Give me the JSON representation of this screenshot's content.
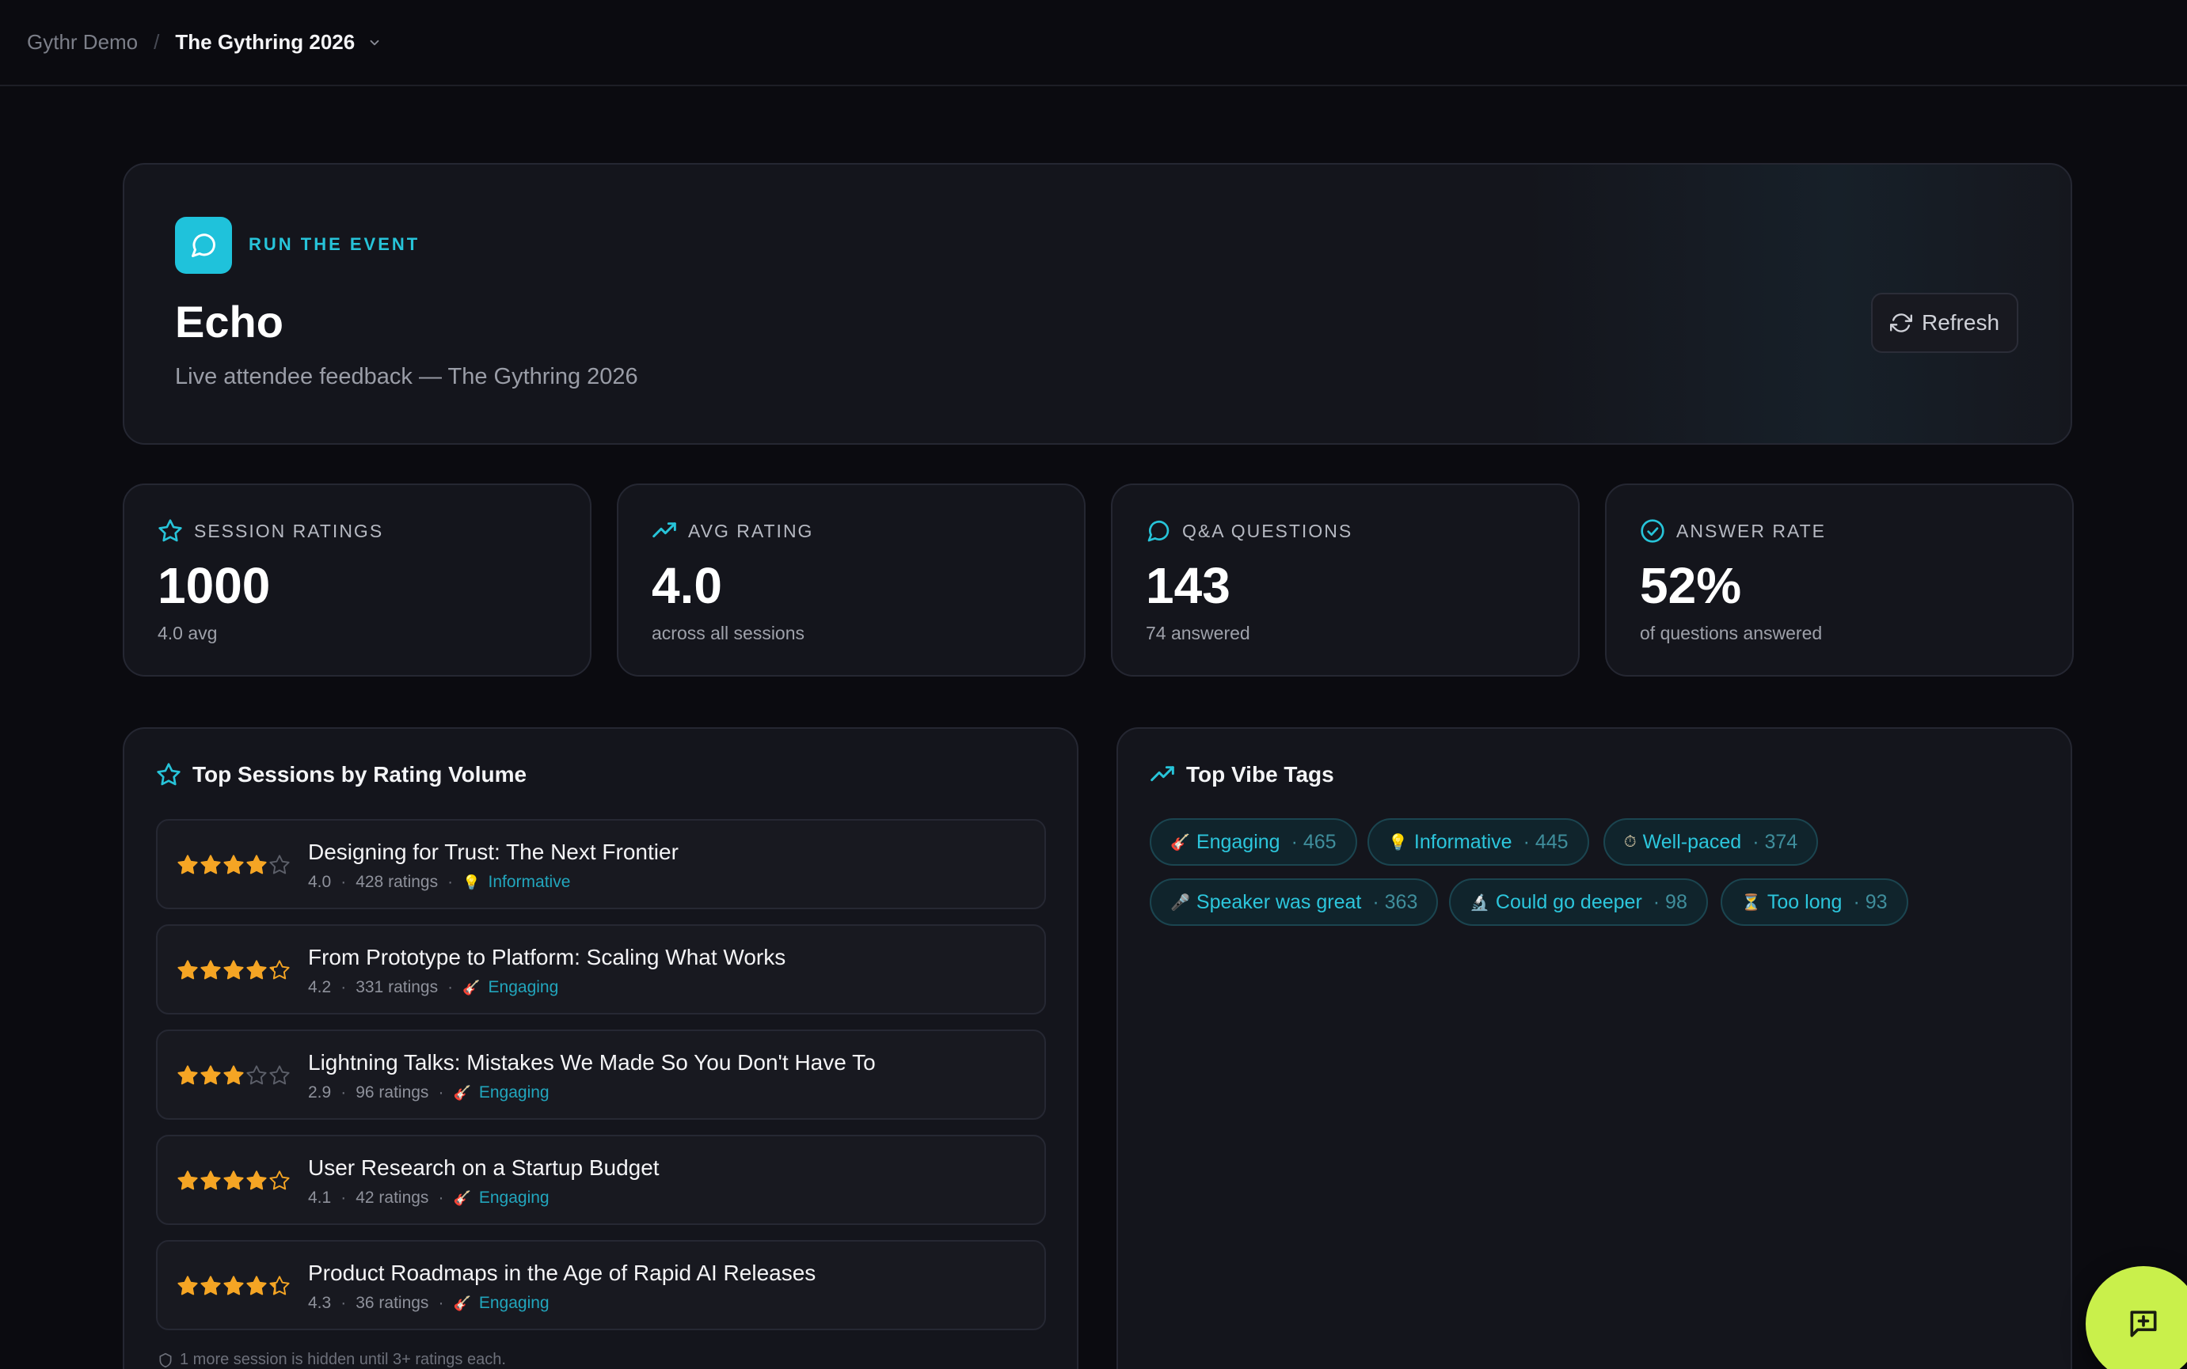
{
  "breadcrumb": {
    "org": "Gythr Demo",
    "separator": "/",
    "event": "The Gythring 2026"
  },
  "hero": {
    "eyebrow": "RUN THE EVENT",
    "title": "Echo",
    "subtitle": "Live attendee feedback — The Gythring 2026",
    "refresh_label": "Refresh"
  },
  "stats": [
    {
      "icon": "star-icon",
      "label": "SESSION RATINGS",
      "value": "1000",
      "sub": "4.0 avg"
    },
    {
      "icon": "trend-up-icon",
      "label": "AVG RATING",
      "value": "4.0",
      "sub": "across all sessions"
    },
    {
      "icon": "chat-bubble-icon",
      "label": "Q&A QUESTIONS",
      "value": "143",
      "sub": "74 answered"
    },
    {
      "icon": "check-circle-icon",
      "label": "ANSWER RATE",
      "value": "52%",
      "sub": "of questions answered"
    }
  ],
  "sessions_panel": {
    "title": "Top Sessions by Rating Volume",
    "items": [
      {
        "title": "Designing for Trust: The Next Frontier",
        "rating": 4.0,
        "rating_text": "4.0",
        "ratings": "428 ratings",
        "tag_emoji": "💡",
        "tag": "Informative"
      },
      {
        "title": "From Prototype to Platform: Scaling What Works",
        "rating": 4.2,
        "rating_text": "4.2",
        "ratings": "331 ratings",
        "tag_emoji": "🎸",
        "tag": "Engaging"
      },
      {
        "title": "Lightning Talks: Mistakes We Made So You Don't Have To",
        "rating": 2.9,
        "rating_text": "2.9",
        "ratings": "96 ratings",
        "tag_emoji": "🎸",
        "tag": "Engaging"
      },
      {
        "title": "User Research on a Startup Budget",
        "rating": 4.1,
        "rating_text": "4.1",
        "ratings": "42 ratings",
        "tag_emoji": "🎸",
        "tag": "Engaging"
      },
      {
        "title": "Product Roadmaps in the Age of Rapid AI Releases",
        "rating": 4.3,
        "rating_text": "4.3",
        "ratings": "36 ratings",
        "tag_emoji": "🎸",
        "tag": "Engaging"
      }
    ],
    "hidden_note": "1 more session is hidden until 3+ ratings each."
  },
  "vibe_panel": {
    "title": "Top Vibe Tags",
    "tags": [
      {
        "emoji": "🎸",
        "label": "Engaging",
        "count": "· 465"
      },
      {
        "emoji": "💡",
        "label": "Informative",
        "count": "· 445"
      },
      {
        "emoji": "⏱",
        "label": "Well-paced",
        "count": "· 374"
      },
      {
        "emoji": "🎤",
        "label": "Speaker was great",
        "count": "· 363"
      },
      {
        "emoji": "🔬",
        "label": "Could go deeper",
        "count": "· 98"
      },
      {
        "emoji": "⏳",
        "label": "Too long",
        "count": "· 93"
      }
    ]
  },
  "colors": {
    "accent": "#27c4d9",
    "star": "#f5a524",
    "fab": "#c9f04b",
    "background": "#0b0b10"
  }
}
